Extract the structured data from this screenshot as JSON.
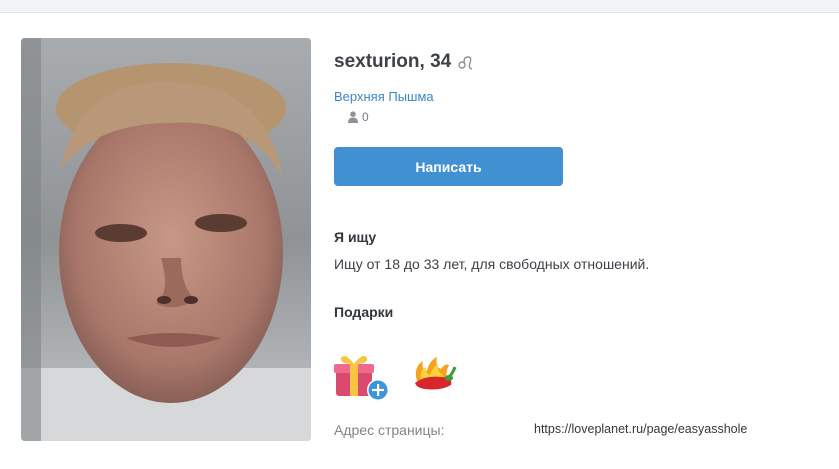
{
  "profile": {
    "name_age": "sexturion, 34",
    "zodiac_icon": "leo-zodiac-icon",
    "city": "Верхняя Пышма",
    "followers_icon": "person-icon",
    "followers_count": "0",
    "write_button_label": "Написать"
  },
  "looking_for": {
    "title": "Я ищу",
    "text": "Ищу от 18 до 33 лет, для свободных отношений."
  },
  "gifts": {
    "title": "Подарки",
    "items": [
      {
        "icon": "gift-box-add-icon"
      },
      {
        "icon": "chili-pepper-fire-icon"
      }
    ]
  },
  "address": {
    "label": "Адрес страницы:",
    "url": "https://loveplanet.ru/page/easyasshole"
  },
  "colors": {
    "accent": "#4190d2",
    "link": "#3a87c8",
    "text": "#3d4248",
    "muted": "#808589"
  }
}
